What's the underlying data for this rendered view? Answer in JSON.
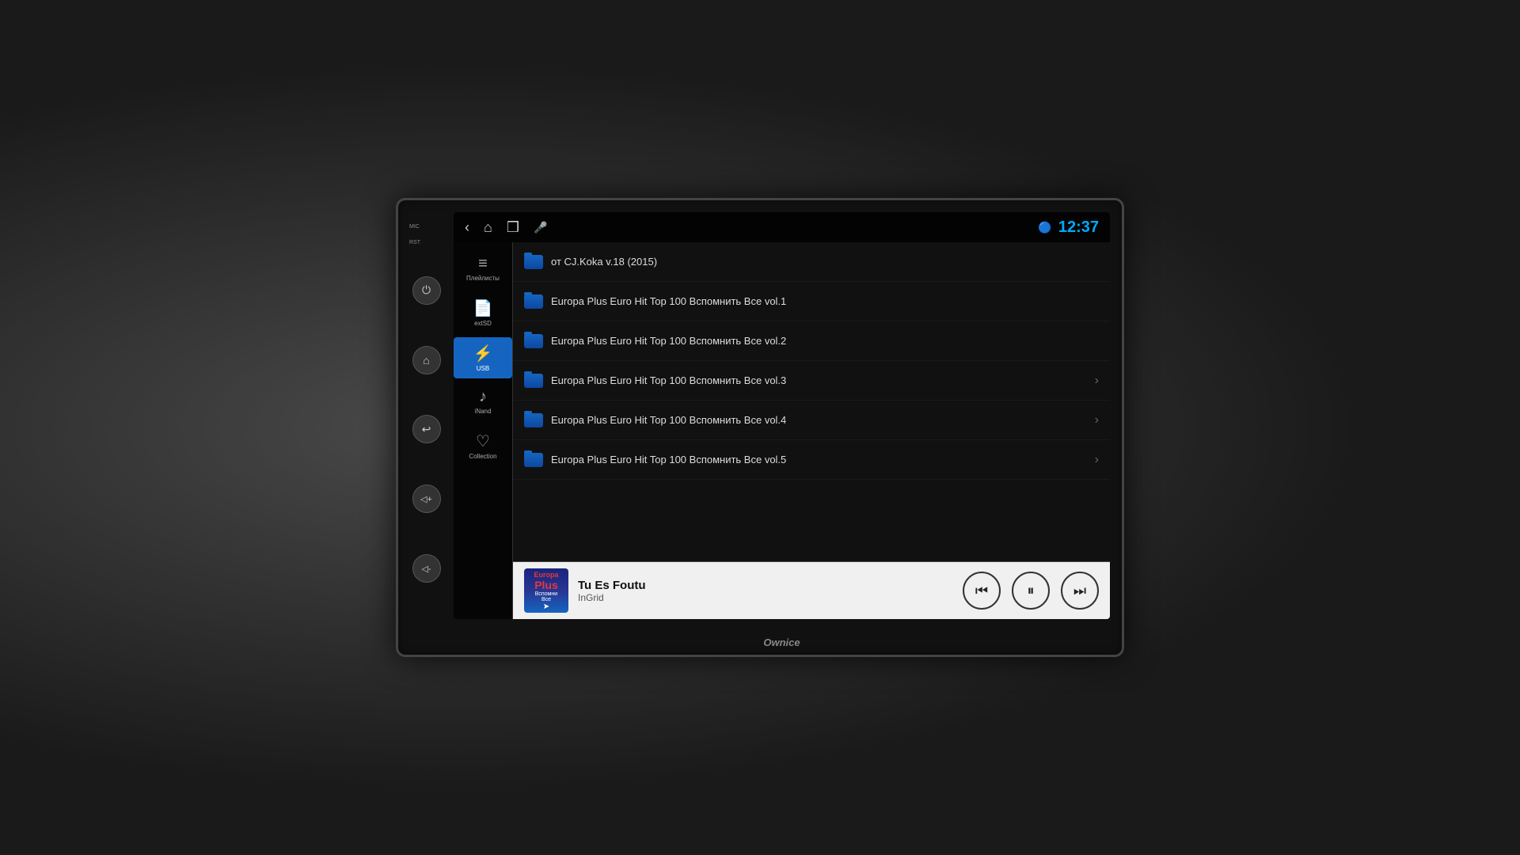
{
  "headUnit": {
    "brand": "Ownice",
    "time": "12:37",
    "micLabel": "MIC",
    "rstLabel": "RST"
  },
  "topBar": {
    "backIcon": "‹",
    "homeIcon": "⌂",
    "windowIcon": "❒",
    "micIcon": "🎤",
    "bluetoothIcon": "🔵"
  },
  "sidebar": {
    "items": [
      {
        "id": "playlists",
        "icon": "≡",
        "label": "Плейлисты",
        "active": false
      },
      {
        "id": "extsd",
        "icon": "📄",
        "label": "extSD",
        "active": false
      },
      {
        "id": "usb",
        "icon": "⚡",
        "label": "USB",
        "active": true
      },
      {
        "id": "inand",
        "icon": "♪",
        "label": "iNand",
        "active": false
      },
      {
        "id": "collection",
        "icon": "♡",
        "label": "Collection",
        "active": false
      }
    ]
  },
  "leftControls": [
    {
      "id": "power",
      "icon": "⏻"
    },
    {
      "id": "home",
      "icon": "⌂"
    },
    {
      "id": "back",
      "icon": "↩"
    },
    {
      "id": "vol-up",
      "icon": "◁+"
    },
    {
      "id": "vol-down",
      "icon": "◁-"
    }
  ],
  "fileList": {
    "items": [
      {
        "id": 0,
        "name": "от CJ.Koka v.18 (2015)",
        "hasChevron": false
      },
      {
        "id": 1,
        "name": "Europa Plus Euro Hit Top 100 Вспомнить Все vol.1",
        "hasChevron": false
      },
      {
        "id": 2,
        "name": "Europa Plus Euro Hit Top 100 Вспомнить Все vol.2",
        "hasChevron": false
      },
      {
        "id": 3,
        "name": "Europa Plus Euro Hit Top 100 Вспомнить Все vol.3",
        "hasChevron": true
      },
      {
        "id": 4,
        "name": "Europa Plus Euro Hit Top 100 Вспомнить Все vol.4",
        "hasChevron": true
      },
      {
        "id": 5,
        "name": "Europa Plus Euro Hit Top 100 Вспомнить Все vol.5",
        "hasChevron": true
      }
    ]
  },
  "nowPlaying": {
    "title": "Tu Es Foutu",
    "artist": "InGrid",
    "albumArtLine1": "Europa",
    "albumArtLine2": "Plus",
    "albumArtLine3": "Вспомни",
    "albumArtLine4": "Все"
  },
  "playerControls": {
    "prevLabel": "⏮",
    "pauseLabel": "⏸",
    "nextLabel": "⏭"
  }
}
